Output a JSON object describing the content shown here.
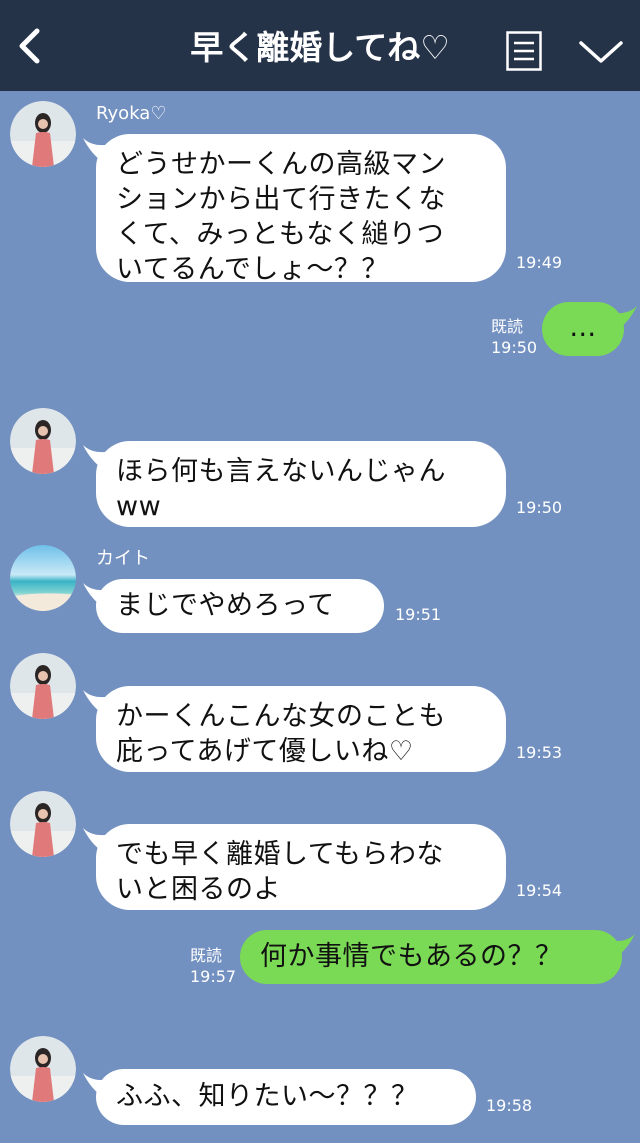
{
  "header": {
    "title": "早く離婚してね♡",
    "back_icon": "chevron-left-icon",
    "menu_icon": "menu-icon",
    "collapse_icon": "chevron-down-icon",
    "background": "#253349"
  },
  "chat": {
    "background": "#7391c0",
    "incoming_bubble_color": "#ffffff",
    "outgoing_bubble_color": "#7ad955",
    "messages": [
      {
        "sender": "Ryoka♡",
        "lines": [
          "どうせかーくんの高級マン",
          "ションから出て行きたくな",
          "くて、みっともなく縋りつ",
          "いてるんでしょ〜？？"
        ],
        "time": "19:49"
      },
      {
        "lines": [
          "…"
        ],
        "read": "既読",
        "time": "19:50"
      },
      {
        "lines": [
          "ほら何も言えないんじゃん",
          "ww"
        ],
        "time": "19:50"
      },
      {
        "sender": "カイト",
        "lines": [
          "まじでやめろって"
        ],
        "time": "19:51"
      },
      {
        "lines": [
          "かーくんこんな女のことも",
          "庇ってあげて優しいね♡"
        ],
        "time": "19:53"
      },
      {
        "lines": [
          "でも早く離婚してもらわな",
          "いと困るのよ"
        ],
        "time": "19:54"
      },
      {
        "lines": [
          "何か事情でもあるの？？"
        ],
        "read": "既読",
        "time": "19:57"
      },
      {
        "lines": [
          "ふふ、知りたい〜？？？"
        ],
        "time": "19:58"
      }
    ]
  }
}
